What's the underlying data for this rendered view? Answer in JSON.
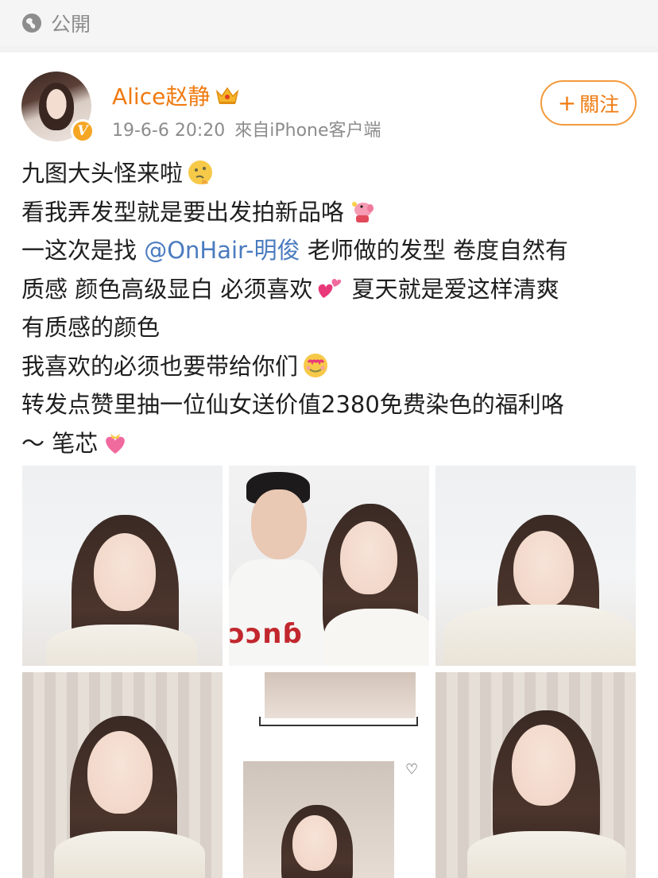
{
  "visibility": {
    "label": "公開"
  },
  "post": {
    "username": "Alice赵静",
    "timestamp": "19-6-6 20:20",
    "source": "來自iPhone客户端",
    "follow_label": "關注",
    "badge": "V",
    "lines": [
      {
        "text": "九图大头怪来啦",
        "emoji": "thinking-face"
      },
      {
        "text": "看我弄发型就是要出发拍新品咯",
        "emoji": "peppa-pig"
      },
      {
        "before": "一这次是找 ",
        "mention": "@OnHair-明俊",
        "after": " 老师做的发型 卷度自然有"
      },
      {
        "text": "质感 颜色高级显白 必须喜欢",
        "emoji": "two-hearts",
        "after": " 夏天就是爱这样清爽"
      },
      {
        "text": "有质感的颜色"
      },
      {
        "text": "我喜欢的必须也要带给你们",
        "emoji": "heart-eyes-face"
      },
      {
        "text": "转发点赞里抽一位仙女送价值2380免费染色的福利咯"
      },
      {
        "text": "～ 笔芯",
        "emoji": "heart-with-ribbon"
      }
    ]
  },
  "colors": {
    "username": "#f07a10",
    "mention": "#4a7bbf",
    "follow_border": "#f39a3d",
    "meta": "#8c8c8c"
  },
  "photos": {
    "count": 6
  }
}
